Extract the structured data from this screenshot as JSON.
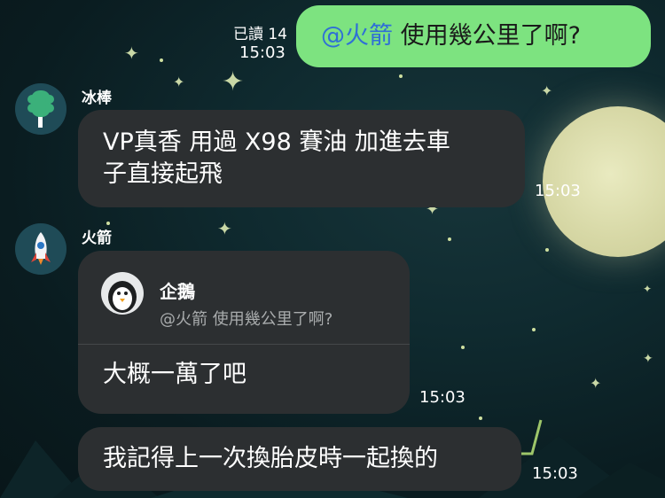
{
  "messages": {
    "outgoing": {
      "read_label": "已讀 14",
      "time": "15:03",
      "mention": "@火箭",
      "text": " 使用幾公里了啊?"
    },
    "msg1": {
      "sender": "冰棒",
      "line1": "VP真香 用過 X98 賽油 加進去車",
      "line2": "子直接起飛",
      "time": "15:03"
    },
    "msg2": {
      "sender": "火箭",
      "reply_to_name": "企鵝",
      "reply_quote": "@火箭 使用幾公里了啊?",
      "text": "大概一萬了吧",
      "time": "15:03"
    },
    "msg3": {
      "text": "我記得上一次換胎皮時一起換的",
      "time": "15:03"
    }
  },
  "colors": {
    "outgoing_bubble": "#7de380",
    "incoming_bubble": "#2c2f31",
    "mention": "#2f6fd6"
  },
  "icons": [
    "popsicle-avatar-icon",
    "rocket-avatar-icon",
    "penguin-avatar-icon"
  ]
}
